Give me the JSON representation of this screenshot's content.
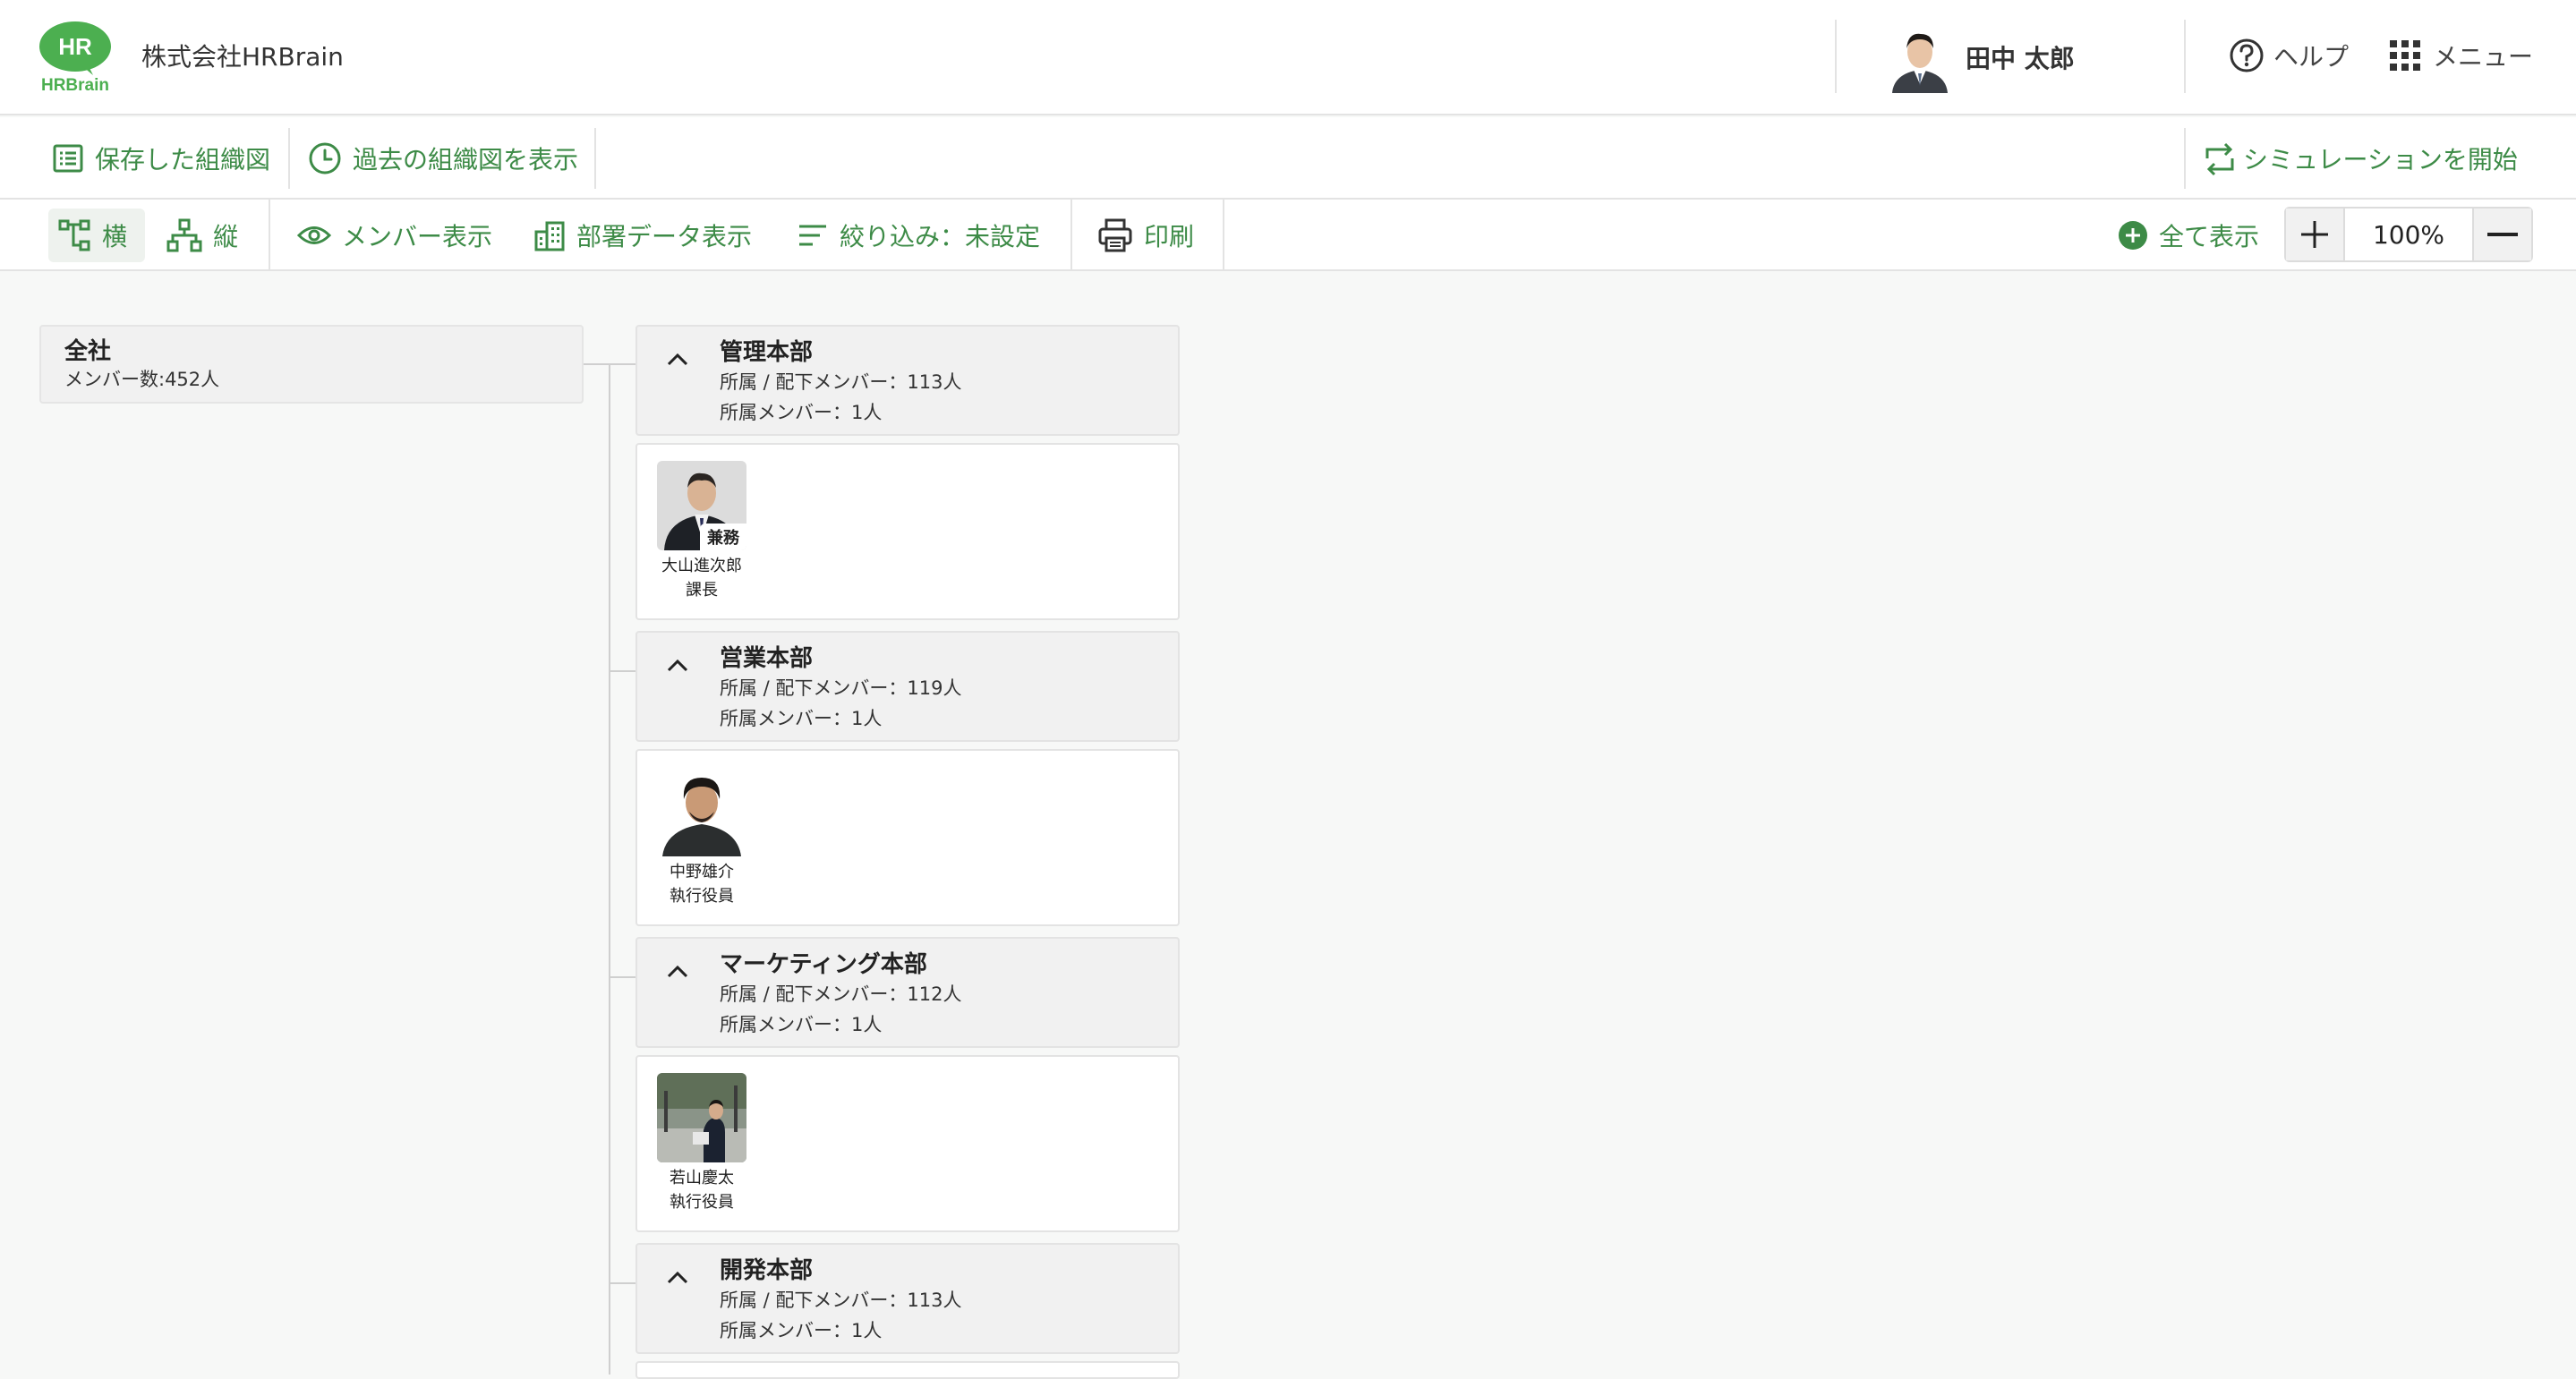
{
  "app": {
    "logo_text": "HR",
    "logo_sub": "HRBrain",
    "company": "株式会社HRBrain"
  },
  "header": {
    "user_name": "田中 太郎",
    "help_label": "ヘルプ",
    "menu_label": "メニュー"
  },
  "toolbar1": {
    "saved_label": "保存した組織図",
    "past_label": "過去の組織図を表示",
    "simulation_label": "シミュレーションを開始"
  },
  "toolbar2": {
    "horizontal_label": "横",
    "vertical_label": "縦",
    "member_view_label": "メンバー表示",
    "dept_data_label": "部署データ表示",
    "filter_label": "絞り込み：未設定",
    "print_label": "印刷",
    "show_all_label": "全て表示",
    "zoom": "100%"
  },
  "org": {
    "root": {
      "name": "全社",
      "count": "メンバー数:452人"
    },
    "departments": [
      {
        "name": "管理本部",
        "line1": "所属 / 配下メンバー：113人",
        "line2": "所属メンバー：1人",
        "member": {
          "name": "大山進次郎",
          "role": "課長",
          "badge": "兼務",
          "photo": "man-in-suit-photo"
        }
      },
      {
        "name": "営業本部",
        "line1": "所属 / 配下メンバー：119人",
        "line2": "所属メンバー：1人",
        "member": {
          "name": "中野雄介",
          "role": "執行役員",
          "photo": "man-dark-shirt-photo"
        }
      },
      {
        "name": "マーケティング本部",
        "line1": "所属 / 配下メンバー：112人",
        "line2": "所属メンバー：1人",
        "member": {
          "name": "若山慶太",
          "role": "執行役員",
          "photo": "man-outdoor-photo"
        }
      },
      {
        "name": "開発本部",
        "line1": "所属 / 配下メンバー：113人",
        "line2": "所属メンバー：1人"
      }
    ]
  },
  "colors": {
    "accent": "#3d8b47",
    "logo": "#4caf50",
    "card_bg": "#f1f1f1"
  }
}
